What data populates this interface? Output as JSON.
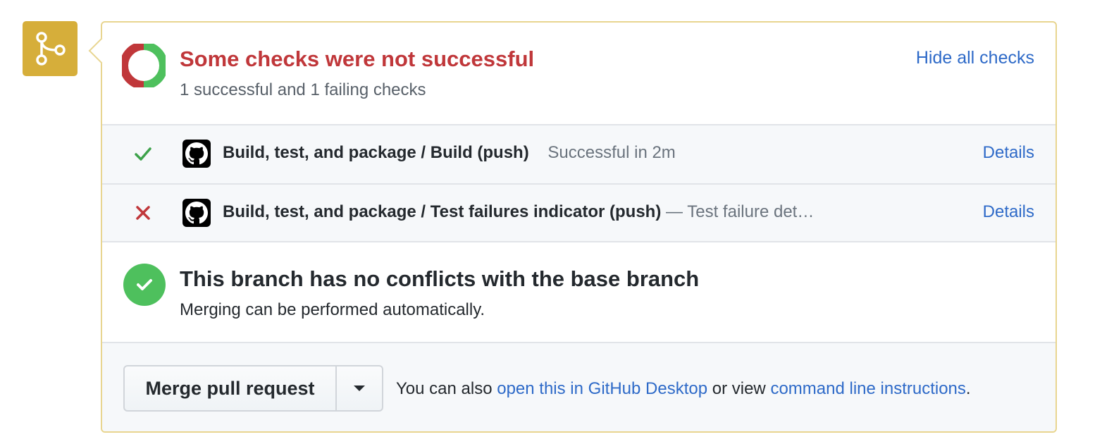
{
  "colors": {
    "accent_link": "#2e6ac8",
    "failure": "#c0373a",
    "success": "#4ec05d",
    "merge_icon_bg": "#d6ae3a"
  },
  "header": {
    "title": "Some checks were not successful",
    "subtitle": "1 successful and 1 failing checks",
    "hide_link": "Hide all checks",
    "status_ring": {
      "successful": 1,
      "failing": 1
    }
  },
  "checks": [
    {
      "status": "success",
      "name": "Build, test, and package / Build (push)",
      "description": "Successful in 2m",
      "details": "Details",
      "icon": "check-icon"
    },
    {
      "status": "failure",
      "name": "Build, test, and package / Test failures indicator (push)",
      "description": "— Test failure det…",
      "details": "Details",
      "icon": "x-icon"
    }
  ],
  "conflict": {
    "title": "This branch has no conflicts with the base branch",
    "subtitle": "Merging can be performed automatically."
  },
  "merge": {
    "button_label": "Merge pull request",
    "text_prefix": "You can also",
    "desktop_link": "open this in GitHub Desktop",
    "text_middle": "or view",
    "cli_link": "command line instructions",
    "text_suffix": "."
  }
}
